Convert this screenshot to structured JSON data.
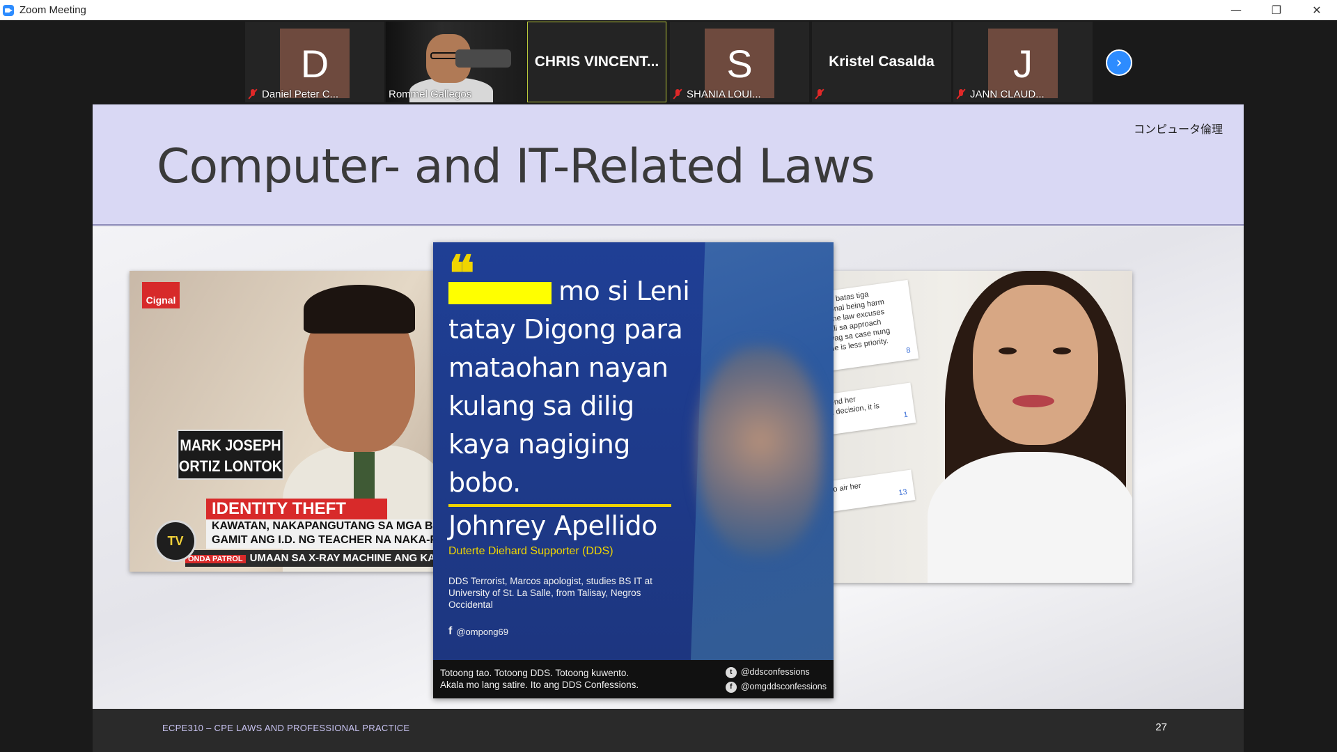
{
  "window": {
    "title": "Zoom Meeting",
    "minimize_glyph": "—",
    "restore_glyph": "❐",
    "close_glyph": "✕"
  },
  "participants": [
    {
      "name": "Daniel Peter C...",
      "initial": "D",
      "muted": true,
      "icon": "mic-muted-icon"
    },
    {
      "name": "Rommel Gallegos",
      "initial": "",
      "muted": false,
      "video": true
    },
    {
      "name": "CHRIS  VINCENT...",
      "initial": "",
      "muted": false,
      "active_speaker": true
    },
    {
      "name": "SHANIA LOUI...",
      "initial": "S",
      "muted": true,
      "icon": "mic-muted-icon"
    },
    {
      "name": "Kristel Casalda",
      "initial": "",
      "muted": true,
      "icon": "mic-muted-icon"
    },
    {
      "name": "JANN CLAUD...",
      "initial": "J",
      "muted": true,
      "icon": "mic-muted-icon"
    }
  ],
  "next_button_icon": "chevron-right-icon",
  "next_button_glyph": "›",
  "slide": {
    "title": "Computer- and IT-Related Laws",
    "tag": "コンピュータ倫理",
    "footer_course": "ECPE310 – CPE LAWS AND PROFESSIONAL PRACTICE",
    "page_number": "27",
    "accent_color": "#d9d8f4"
  },
  "news_image": {
    "channel": "Cignal",
    "name_line1": "MARK JOSEPH",
    "name_line2": "ORTIZ LONTOK",
    "banner": "IDENTITY THEFT",
    "ticker_line1": "KAWATAN, NAKAPANGUTANG SA MGA BANGKO N",
    "ticker_line2": "GAMIT ANG I.D. NG TEACHER NA NAKA-POST SA S",
    "ticker_show": "ONDA PATROL",
    "ticker_line3": "UMAAN SA X-RAY MACHINE ANG KANYAN",
    "logo": "TV"
  },
  "quote_card": {
    "quote_glyph": "❝",
    "lines": [
      "mo si Leni",
      "tatay Digong para",
      "mataohan nayan",
      "kulang sa dilig",
      "kaya nagiging",
      "bobo."
    ],
    "author": "Johnrey Apellido",
    "role": "Duterte Diehard Supporter (DDS)",
    "bio": "DDS Terrorist, Marcos apologist, studies BS IT at University of St. La Salle, from Talisay, Negros Occidental",
    "handle": "@ompong69",
    "footer_line1": "Totoong tao. Totoong DDS. Totoong kuwento.",
    "footer_line2": "Akala mo lang satire. Ito ang DDS Confessions.",
    "twitter_handle": "@ddsconfessions",
    "facebook_handle": "@omgddsconfessions"
  },
  "comments": [
    {
      "text": "may batas tiga\nssional being harm\nof the law excuses\nmali sa approach\nawag sa case nung\nt he is less priority.",
      "likes": "8"
    },
    {
      "text": "I send her\ne a decision, it is",
      "likes": "1"
    },
    {
      "text": "ht to air her",
      "likes": "13"
    }
  ]
}
